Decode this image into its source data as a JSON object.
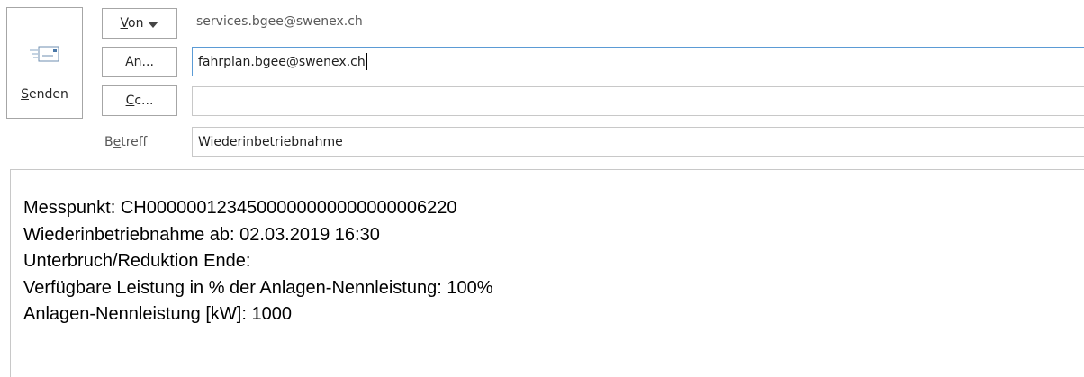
{
  "send": {
    "label": "Senden",
    "accesskey": "S",
    "icon": "send-mail-icon"
  },
  "from": {
    "button_label": "Von",
    "accesskey": "V",
    "value": "services.bgee@swenex.ch"
  },
  "to": {
    "button_label": "An...",
    "accesskey": "n",
    "value": "fahrplan.bgee@swenex.ch"
  },
  "cc": {
    "button_label": "Cc...",
    "accesskey": "C",
    "value": ""
  },
  "subject": {
    "label": "Betreff",
    "accesskey": "e",
    "value": "Wiederinbetriebnahme"
  },
  "body": {
    "lines": [
      "Messpunkt: CH0000001234500000000000000006220",
      "Wiederinbetriebnahme ab: 02.03.2019 16:30",
      "Unterbruch/Reduktion Ende:",
      "Verfügbare Leistung in % der Anlagen-Nennleistung: 100%",
      "Anlagen-Nennleistung [kW]: 1000"
    ]
  },
  "colors": {
    "focus_border": "#5b9bd5",
    "field_border": "#c8c8c8",
    "button_border": "#a6a6a6"
  }
}
